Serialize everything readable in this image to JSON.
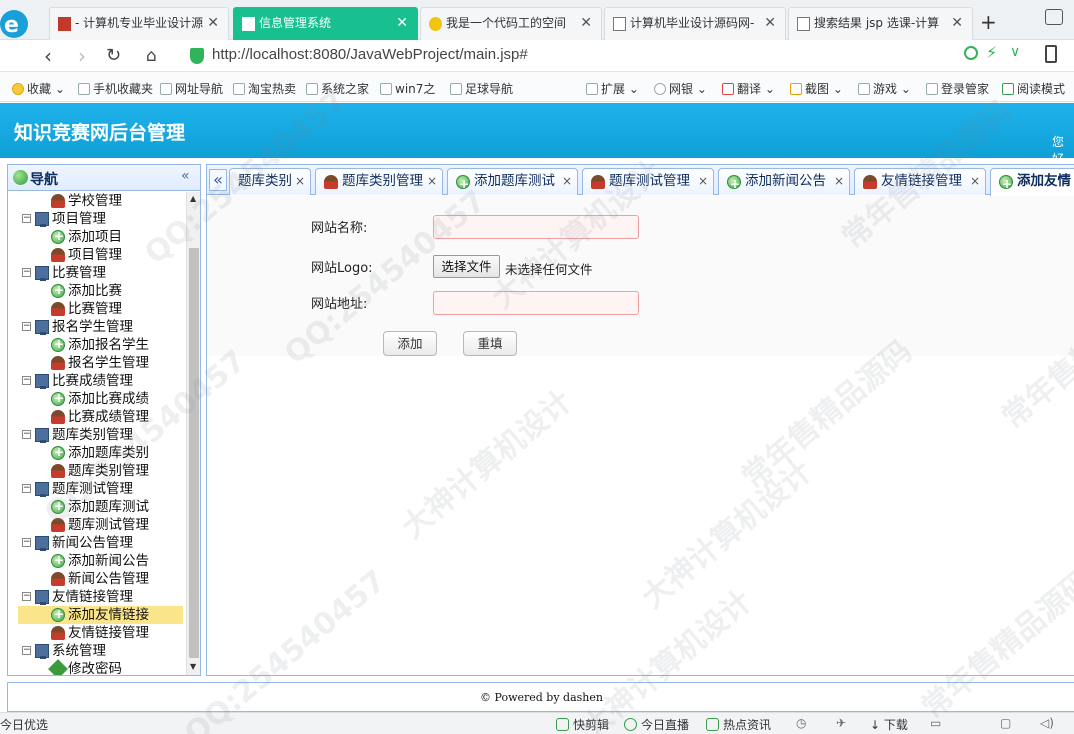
{
  "browser": {
    "tabs": [
      {
        "title": "- 计算机专业毕业设计源"
      },
      {
        "title": "信息管理系统",
        "active": true
      },
      {
        "title": "我是一个代码工的空间"
      },
      {
        "title": "计算机毕业设计源码网-"
      },
      {
        "title": "搜索结果 jsp 选课-计算"
      }
    ],
    "new_tab": "+",
    "url": "http://localhost:8080/JavaWebProject/main.jsp#",
    "bookmarks": [
      "收藏",
      "手机收藏夹",
      "网址导航",
      "淘宝热卖",
      "系统之家",
      "win7之",
      "足球导航"
    ],
    "bookmark_tools": [
      "扩展",
      "网银",
      "翻译",
      "截图",
      "游戏",
      "登录管家",
      "阅读模式"
    ]
  },
  "app": {
    "title": "知识竞赛网后台管理",
    "welcome": "您好"
  },
  "nav": {
    "title": "导航",
    "collapse": "«",
    "items": [
      {
        "label": "学校管理",
        "level": 2,
        "icon": "user"
      },
      {
        "label": "项目管理",
        "level": 1,
        "icon": "pc",
        "toggle": "⊟"
      },
      {
        "label": "添加项目",
        "level": 2,
        "icon": "plus"
      },
      {
        "label": "项目管理",
        "level": 2,
        "icon": "user"
      },
      {
        "label": "比赛管理",
        "level": 1,
        "icon": "pc",
        "toggle": "⊟"
      },
      {
        "label": "添加比赛",
        "level": 2,
        "icon": "plus"
      },
      {
        "label": "比赛管理",
        "level": 2,
        "icon": "user"
      },
      {
        "label": "报名学生管理",
        "level": 1,
        "icon": "pc",
        "toggle": "⊟"
      },
      {
        "label": "添加报名学生",
        "level": 2,
        "icon": "plus"
      },
      {
        "label": "报名学生管理",
        "level": 2,
        "icon": "user"
      },
      {
        "label": "比赛成绩管理",
        "level": 1,
        "icon": "pc",
        "toggle": "⊟"
      },
      {
        "label": "添加比赛成绩",
        "level": 2,
        "icon": "plus"
      },
      {
        "label": "比赛成绩管理",
        "level": 2,
        "icon": "user"
      },
      {
        "label": "题库类别管理",
        "level": 1,
        "icon": "pc",
        "toggle": "⊟"
      },
      {
        "label": "添加题库类别",
        "level": 2,
        "icon": "plus"
      },
      {
        "label": "题库类别管理",
        "level": 2,
        "icon": "user"
      },
      {
        "label": "题库测试管理",
        "level": 1,
        "icon": "pc",
        "toggle": "⊟"
      },
      {
        "label": "添加题库测试",
        "level": 2,
        "icon": "plus"
      },
      {
        "label": "题库测试管理",
        "level": 2,
        "icon": "user"
      },
      {
        "label": "新闻公告管理",
        "level": 1,
        "icon": "pc",
        "toggle": "⊟"
      },
      {
        "label": "添加新闻公告",
        "level": 2,
        "icon": "plus"
      },
      {
        "label": "新闻公告管理",
        "level": 2,
        "icon": "user"
      },
      {
        "label": "友情链接管理",
        "level": 1,
        "icon": "pc",
        "toggle": "⊟"
      },
      {
        "label": "添加友情链接",
        "level": 2,
        "icon": "plus",
        "selected": true
      },
      {
        "label": "友情链接管理",
        "level": 2,
        "icon": "user"
      },
      {
        "label": "系统管理",
        "level": 1,
        "icon": "pc",
        "toggle": "⊟"
      },
      {
        "label": "修改密码",
        "level": 2,
        "icon": "pen"
      }
    ]
  },
  "content_tabs": {
    "scroll_left": "«",
    "tabs": [
      {
        "label": "题库类别",
        "icon": "none"
      },
      {
        "label": "题库类别管理",
        "icon": "user"
      },
      {
        "label": "添加题库测试",
        "icon": "plus"
      },
      {
        "label": "题库测试管理",
        "icon": "user"
      },
      {
        "label": "添加新闻公告",
        "icon": "plus"
      },
      {
        "label": "友情链接管理",
        "icon": "user"
      },
      {
        "label": "添加友情",
        "icon": "plus",
        "active": true
      }
    ],
    "close": "×"
  },
  "form": {
    "name_label": "网站名称:",
    "name_value": "",
    "logo_label": "网站Logo:",
    "file_button": "选择文件",
    "file_status": "未选择任何文件",
    "url_label": "网站地址:",
    "url_value": "",
    "add_button": "添加",
    "reset_button": "重填"
  },
  "footer": {
    "powered": "© Powered by dashen"
  },
  "statusbar": {
    "left": "今日优选",
    "items": [
      "快剪辑",
      "今日直播",
      "热点资讯",
      "下载"
    ]
  },
  "watermark": {
    "texts": [
      "QQ:254540457",
      "大神计算机设计",
      "常年售精品源码"
    ]
  }
}
